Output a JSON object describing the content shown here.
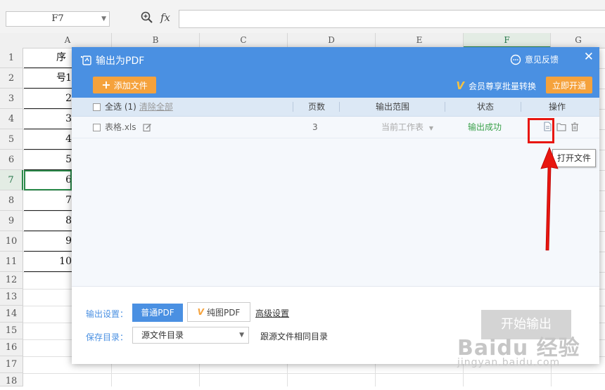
{
  "formula_bar": {
    "name_box_value": "F7",
    "fx_label": "fx"
  },
  "spreadsheet": {
    "columns": [
      "A",
      "B",
      "C",
      "D",
      "E",
      "F",
      "G"
    ],
    "active_column": "F",
    "rows": [
      "1",
      "2",
      "3",
      "4",
      "5",
      "6",
      "7",
      "8",
      "9",
      "10",
      "11",
      "12",
      "13",
      "14",
      "15",
      "16",
      "17",
      "18"
    ],
    "active_row": "7",
    "column_a_values": [
      "序号",
      "1",
      "2",
      "3",
      "4",
      "5",
      "6",
      "7",
      "8",
      "9",
      "10"
    ]
  },
  "dialog": {
    "title": "输出为PDF",
    "feedback_label": "意见反馈",
    "close_label": "✕",
    "add_file_label": "添加文件",
    "vip_label": "会员尊享批量转换",
    "open_now_label": "立即开通",
    "table": {
      "headers": {
        "select_all": "全选 (1)",
        "clear_all": "清除全部",
        "pages": "页数",
        "range": "输出范围",
        "status": "状态",
        "actions": "操作"
      },
      "rows": [
        {
          "file": "表格.xls",
          "pages": "3",
          "range": "当前工作表",
          "status": "输出成功"
        }
      ]
    },
    "tooltip": "打开文件",
    "footer": {
      "output_settings_label": "输出设置：",
      "normal_pdf": "普通PDF",
      "image_pdf": "纯图PDF",
      "advanced_settings": "高级设置",
      "save_dir_label": "保存目录：",
      "save_dir_value": "源文件目录",
      "same_dir_text": "跟源文件相同目录",
      "start_button": "开始输出"
    }
  },
  "watermark": {
    "main": "Baidu 经验",
    "sub": "jingyan.baidu.com"
  },
  "colors": {
    "dialog_blue": "#4a90e2",
    "orange_button": "#f5a23c",
    "success_green": "#3aa14a",
    "highlight_red": "#e8160f"
  }
}
